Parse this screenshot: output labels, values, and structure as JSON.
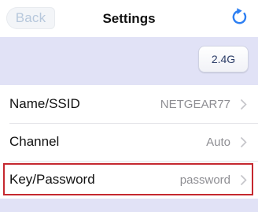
{
  "nav": {
    "back_label": "Back",
    "title": "Settings",
    "refresh_icon": "refresh-icon"
  },
  "band": {
    "button_label": "2.4G"
  },
  "rows": [
    {
      "label": "Name/SSID",
      "value": "NETGEAR77"
    },
    {
      "label": "Channel",
      "value": "Auto"
    },
    {
      "label": "Key/Password",
      "value": "password",
      "highlighted": true
    }
  ],
  "colors": {
    "accent": "#2d7ff2",
    "band_background": "#e1e2f6",
    "highlight": "#c5282f",
    "value_text": "#8e8e93"
  }
}
